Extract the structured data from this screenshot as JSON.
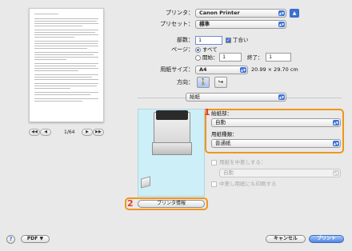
{
  "preview": {
    "page_indicator": "1/64",
    "first_label": "◀◀",
    "prev_label": "◀",
    "next_label": "▶",
    "last_label": "▶▶"
  },
  "form": {
    "printer_label": "プリンタ：",
    "printer_value": "Canon Printer",
    "preset_label": "プリセット：",
    "preset_value": "標準",
    "copies_label": "部数：",
    "copies_value": "1",
    "collate_label": "丁合い",
    "pages_label": "ページ：",
    "pages_all_label": "すべて",
    "pages_from_label": "開始：",
    "pages_from_value": "1",
    "pages_to_label": "終了：",
    "pages_to_value": "1",
    "paper_size_label": "用紙サイズ：",
    "paper_size_value": "A4",
    "paper_size_dims": "20.99 × 29.70 cm",
    "orientation_label": "方向：",
    "section_value": "給紙"
  },
  "feed": {
    "source_label": "給紙部：",
    "source_value": "自動",
    "media_label": "用紙種類：",
    "media_value": "普通紙",
    "change_paper_label": "用紙を中差しする：",
    "change_paper_value": "自動",
    "print_on_insert_label": "中差し用紙にも印刷する"
  },
  "callouts": {
    "one": "1",
    "two": "2"
  },
  "printer_info_button": "プリンタ情報",
  "footer": {
    "help": "?",
    "pdf_button": "PDF ▼",
    "cancel_button": "キャンセル",
    "print_button": "プリント"
  },
  "colors": {
    "highlight": "#f0961c",
    "callout": "#e0402a",
    "accent": "#3b72d6"
  }
}
